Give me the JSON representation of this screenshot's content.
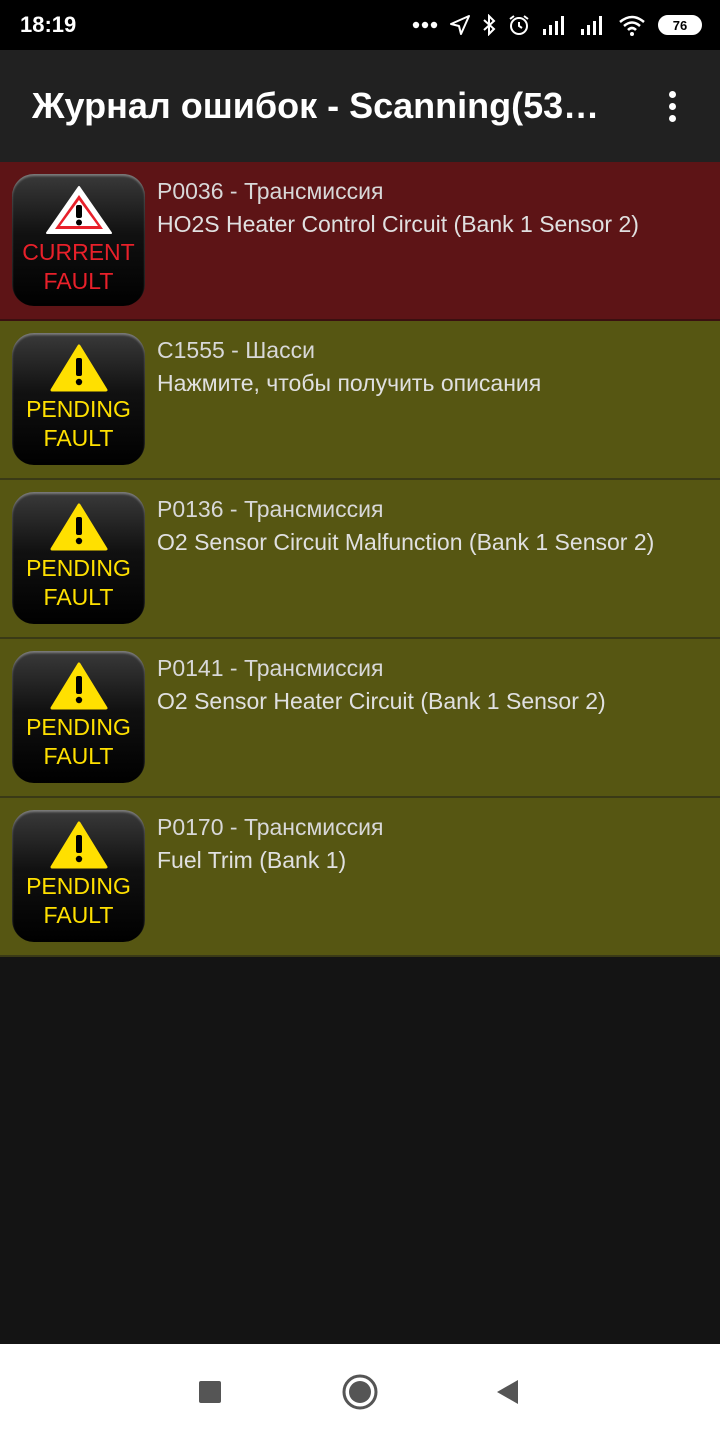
{
  "status_bar": {
    "time": "18:19",
    "battery": "76",
    "icons": [
      "more-dots-icon",
      "location-arrow-icon",
      "bluetooth-icon",
      "alarm-icon",
      "signal-icon",
      "signal-icon",
      "wifi-icon",
      "battery-icon"
    ]
  },
  "app_bar": {
    "title": "Журнал ошибок - Scanning(53…",
    "menu_icon": "overflow-menu-icon"
  },
  "colors": {
    "current_row": "#5d1416",
    "pending_row": "#565612",
    "current_text": "#e8202a",
    "pending_text": "#ffe000"
  },
  "faults": [
    {
      "status": "current",
      "badge_line1": "CURRENT",
      "badge_line2": "FAULT",
      "code": "P0036 - Трансмиссия",
      "description": "HO2S Heater Control Circuit (Bank 1 Sensor 2)"
    },
    {
      "status": "pending",
      "badge_line1": "PENDING",
      "badge_line2": "FAULT",
      "code": "C1555 - Шасси",
      "description": "Нажмите, чтобы получить описания"
    },
    {
      "status": "pending",
      "badge_line1": "PENDING",
      "badge_line2": "FAULT",
      "code": "P0136 - Трансмиссия",
      "description": "O2 Sensor Circuit Malfunction (Bank 1 Sensor 2)"
    },
    {
      "status": "pending",
      "badge_line1": "PENDING",
      "badge_line2": "FAULT",
      "code": "P0141 - Трансмиссия",
      "description": "O2 Sensor Heater Circuit (Bank 1 Sensor 2)"
    },
    {
      "status": "pending",
      "badge_line1": "PENDING",
      "badge_line2": "FAULT",
      "code": "P0170 - Трансмиссия",
      "description": "Fuel Trim (Bank 1)"
    }
  ],
  "nav_bar": {
    "buttons": [
      "recents-square-icon",
      "home-circle-icon",
      "back-triangle-icon"
    ]
  }
}
